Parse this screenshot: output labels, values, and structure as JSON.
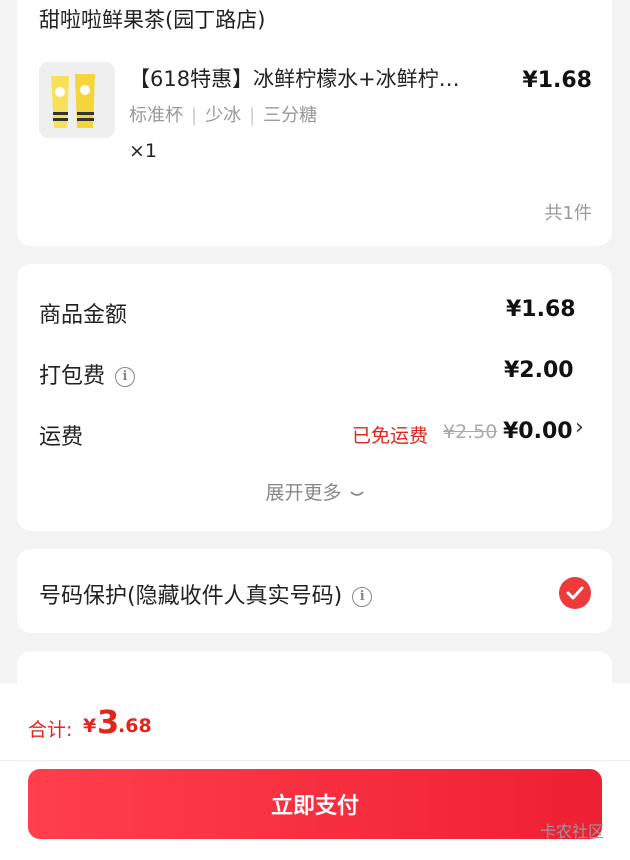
{
  "order": {
    "store_name": "甜啦啦鲜果茶(园丁路店)",
    "product_name": "【618特惠】冰鲜柠檬水+冰鲜柠…",
    "price": "¥1.68",
    "specs": [
      "标准杯",
      "少冰",
      "三分糖"
    ],
    "quantity": "×1",
    "item_count": "共1件"
  },
  "fees": {
    "goods_label": "商品金额",
    "goods_value": "¥1.68",
    "packing_label": "打包费",
    "packing_value": "¥2.00",
    "shipping_label": "运费",
    "shipping_free_text": "已免运费",
    "shipping_original": "¥2.50",
    "shipping_value": "¥0.00",
    "expand_label": "展开更多"
  },
  "privacy": {
    "label": "号码保护(隐藏收件人真实号码)",
    "checked": true
  },
  "footer": {
    "total_label": "合计:",
    "total_symbol": "¥",
    "total_integer": "3",
    "total_decimal": ".68",
    "pay_label": "立即支付",
    "watermark": "卡农社区"
  },
  "colors": {
    "accent": "#e1251b",
    "button": "#ee2033",
    "background": "#f3f3f3"
  },
  "icons": [
    "info-icon",
    "chevron-right-icon",
    "chevron-down-icon",
    "check-icon"
  ]
}
